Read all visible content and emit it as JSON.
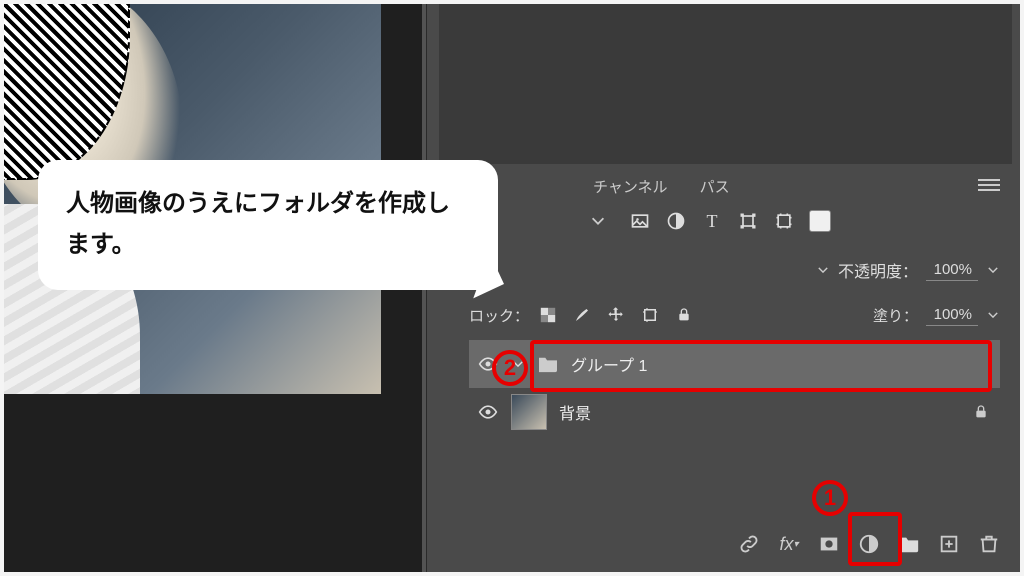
{
  "tabs": {
    "channels": "チャンネル",
    "paths": "パス"
  },
  "opacity": {
    "label": "不透明度：",
    "value": "100%"
  },
  "lock": {
    "label": "ロック："
  },
  "fill": {
    "label": "塗り：",
    "value": "100%"
  },
  "layers": {
    "group": {
      "name": "グループ 1"
    },
    "bg": {
      "name": "背景"
    }
  },
  "speech": "人物画像のうえにフォルダを作成します。",
  "annotations": {
    "one": "1",
    "two": "2"
  }
}
